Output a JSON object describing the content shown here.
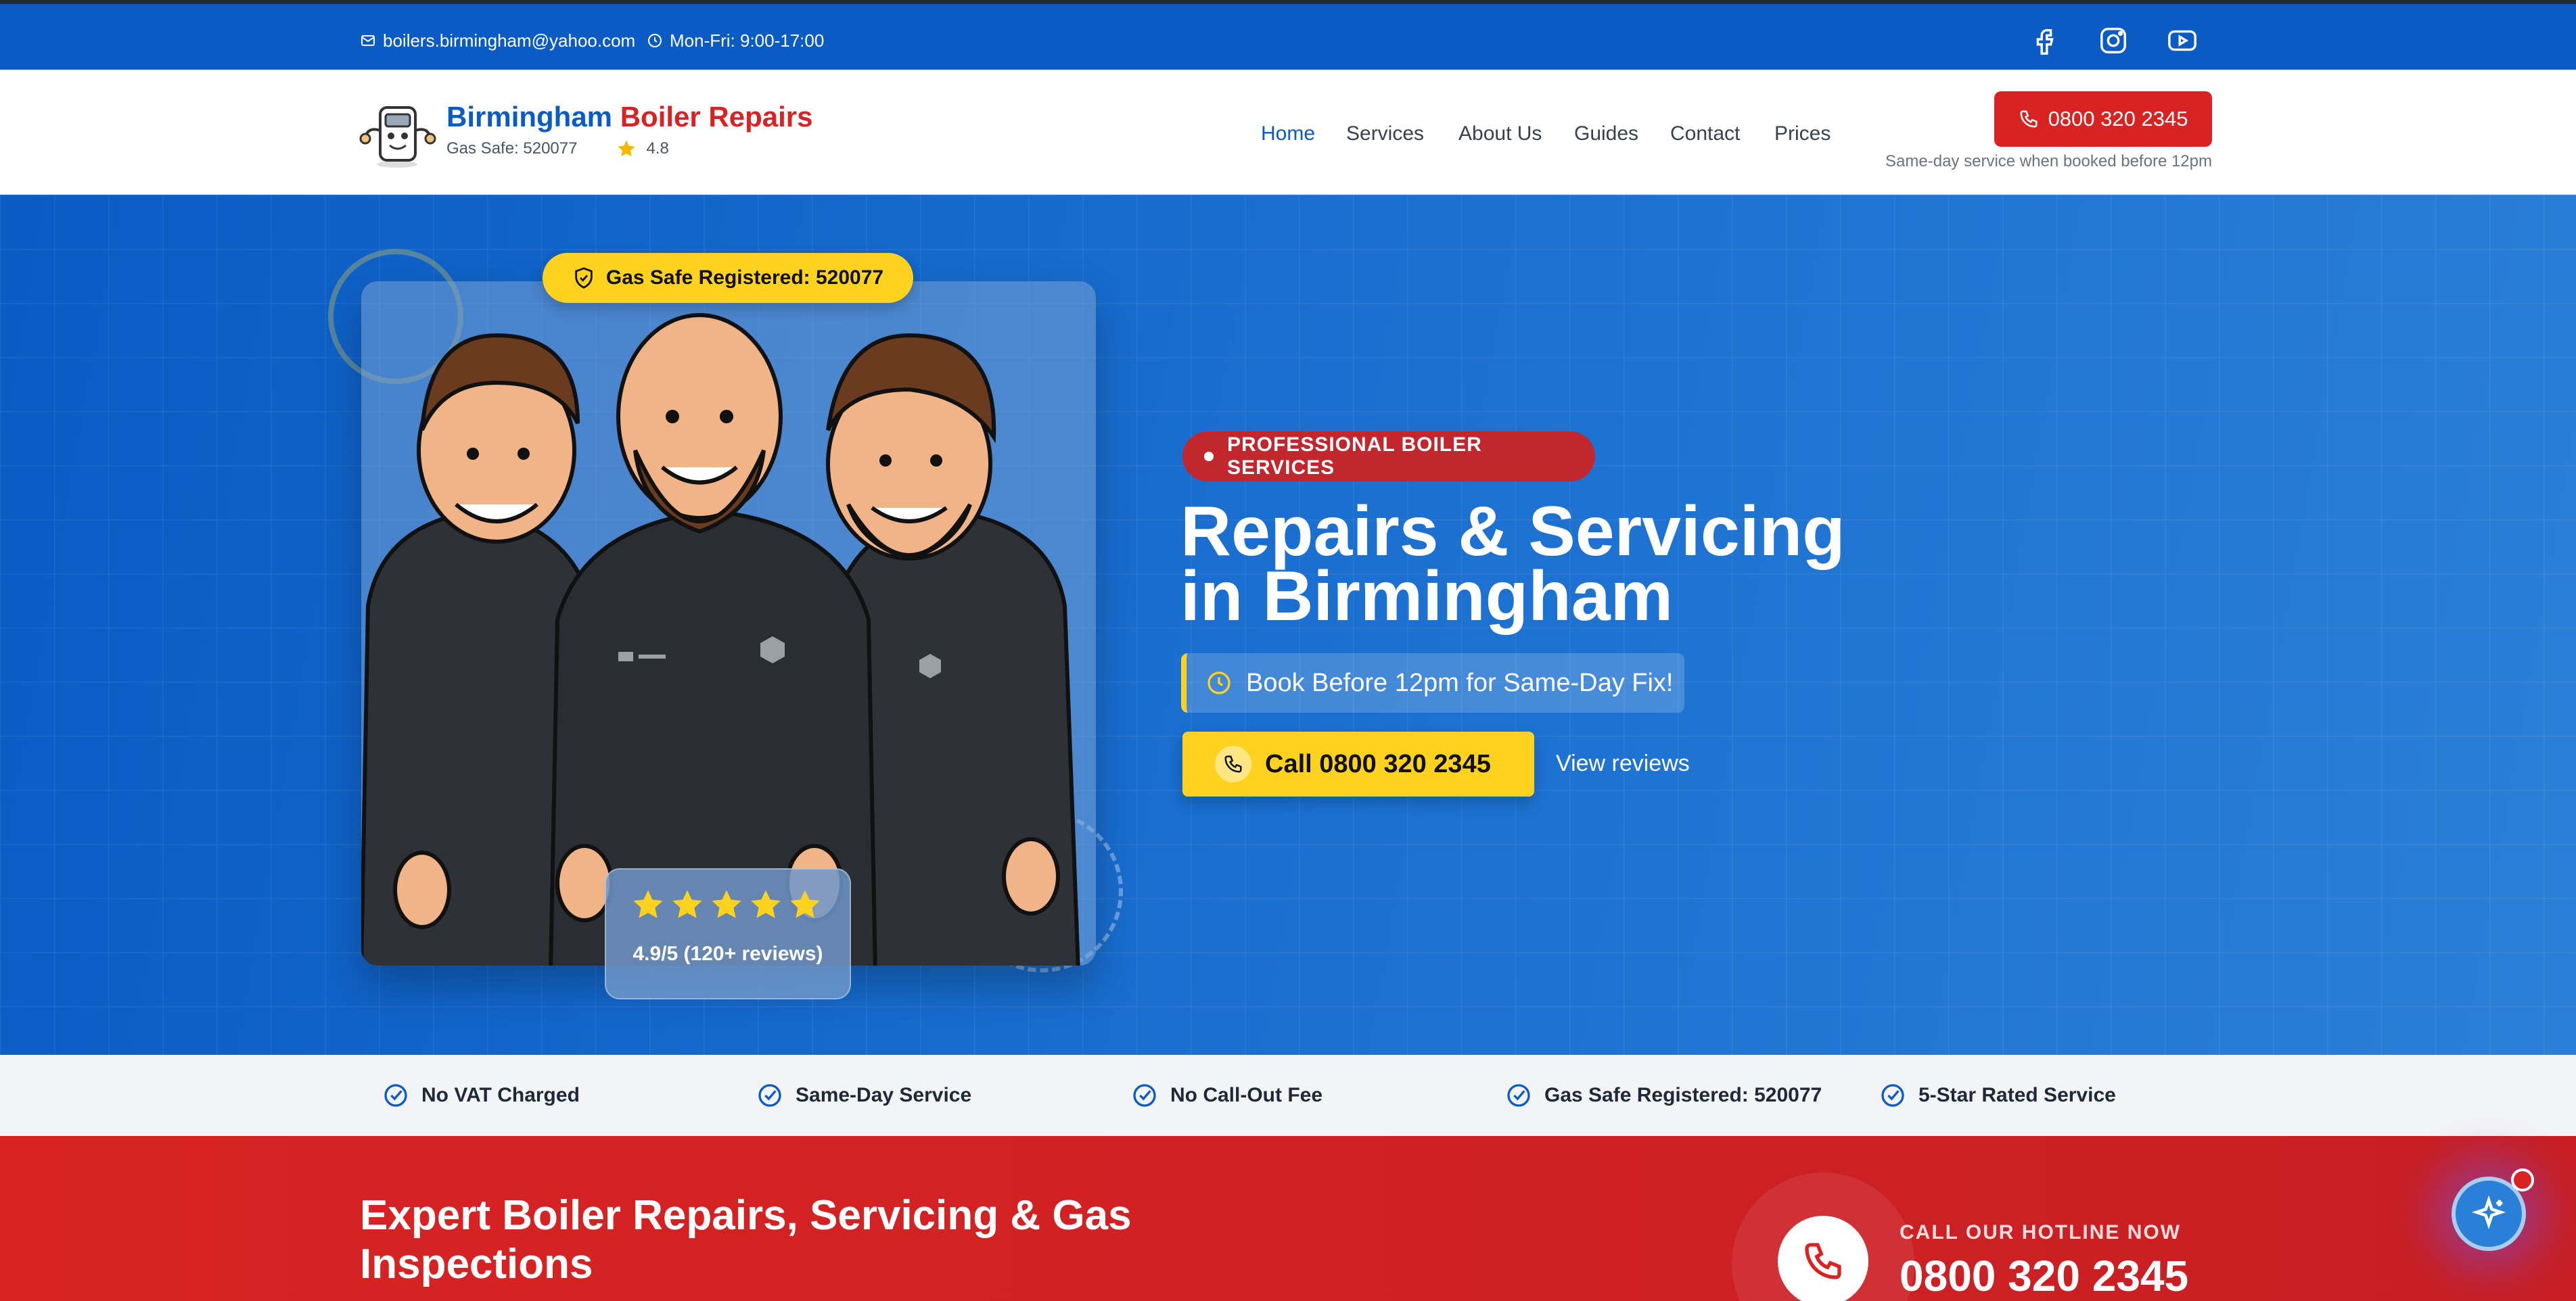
{
  "topbar": {
    "email": "boilers.birmingham@yahoo.com",
    "hours": "Mon-Fri: 9:00-17:00",
    "social": [
      "facebook-icon",
      "instagram-icon",
      "youtube-icon"
    ]
  },
  "header": {
    "brand_part1": "Birmingham",
    "brand_part2": "Boiler Repairs",
    "gas_safe": "Gas Safe: 520077",
    "rating": "4.8",
    "nav": [
      "Home",
      "Services",
      "About Us",
      "Guides",
      "Contact",
      "Prices"
    ],
    "phone_button": "0800 320 2345",
    "note": "Same-day service when booked before 12pm"
  },
  "hero": {
    "badge": "Gas Safe Registered: 520077",
    "rating_text": "4.9/5 (120+ reviews)",
    "pill": "PROFESSIONAL BOILER SERVICES",
    "title_line1": "Repairs & Servicing",
    "title_line2": "in Birmingham",
    "book_text": "Book Before 12pm for Same-Day Fix!",
    "call_button": "Call 0800 320 2345",
    "view_reviews": "View reviews"
  },
  "features": [
    "No VAT Charged",
    "Same-Day Service",
    "No Call-Out Fee",
    "Gas Safe Registered: 520077",
    "5-Star Rated Service"
  ],
  "red_section": {
    "heading": "Expert Boiler Repairs, Servicing & Gas Inspections",
    "hotline_label": "CALL OUR HOTLINE NOW",
    "hotline_number": "0800 320 2345"
  },
  "colors": {
    "primary_blue": "#0a5bc4",
    "accent_red": "#d92323",
    "accent_yellow": "#ffd21f"
  }
}
